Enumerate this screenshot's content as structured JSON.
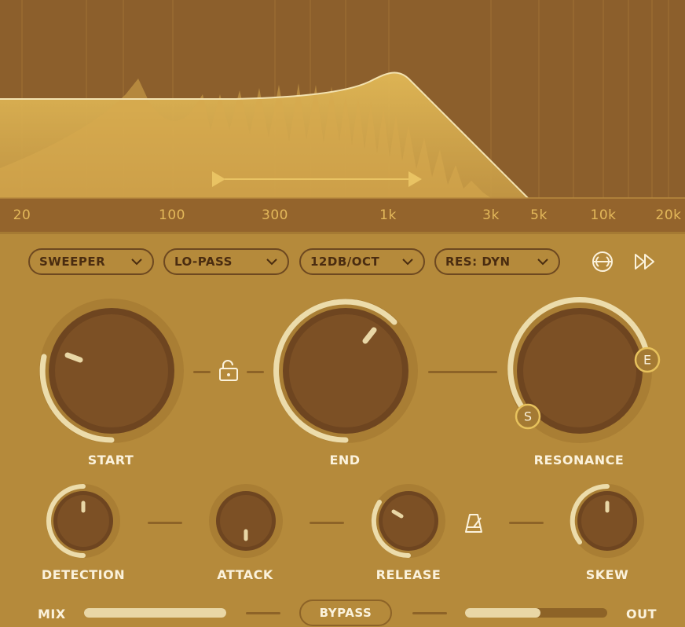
{
  "spectrum": {
    "freq_labels": [
      "20",
      "100",
      "300",
      "1k",
      "3k",
      "5k",
      "10k",
      "20k"
    ]
  },
  "dropdowns": {
    "mode": "SWEEPER",
    "filter_type": "LO-PASS",
    "slope": "12DB/OCT",
    "resonance_mode": "RES: DYN"
  },
  "icons": {
    "stereo": "stereo-link-icon",
    "fast_forward": "fast-forward-icon",
    "lock": "unlock-icon",
    "metronome": "metronome-icon"
  },
  "knobs": {
    "start": {
      "label": "START",
      "value": 0.22
    },
    "end": {
      "label": "END",
      "value": 0.62
    },
    "resonance": {
      "label": "RESONANCE",
      "start_marker": "S",
      "end_marker": "E"
    },
    "detection": {
      "label": "DETECTION",
      "value": 0.5
    },
    "attack": {
      "label": "ATTACK",
      "value": 0.0
    },
    "release": {
      "label": "RELEASE",
      "value": 0.33
    },
    "skew": {
      "label": "SKEW",
      "value": 0.5
    }
  },
  "bottom": {
    "mix_label": "MIX",
    "bypass_label": "BYPASS",
    "out_label": "OUT",
    "mix_value": 1.0,
    "out_value": 0.53
  },
  "colors": {
    "accent": "#e9d7a6",
    "knob_body": "#6f4620",
    "background": "#b58a3b",
    "spectrum_bg": "#8c5f2c",
    "marker": "#e7c25d"
  }
}
